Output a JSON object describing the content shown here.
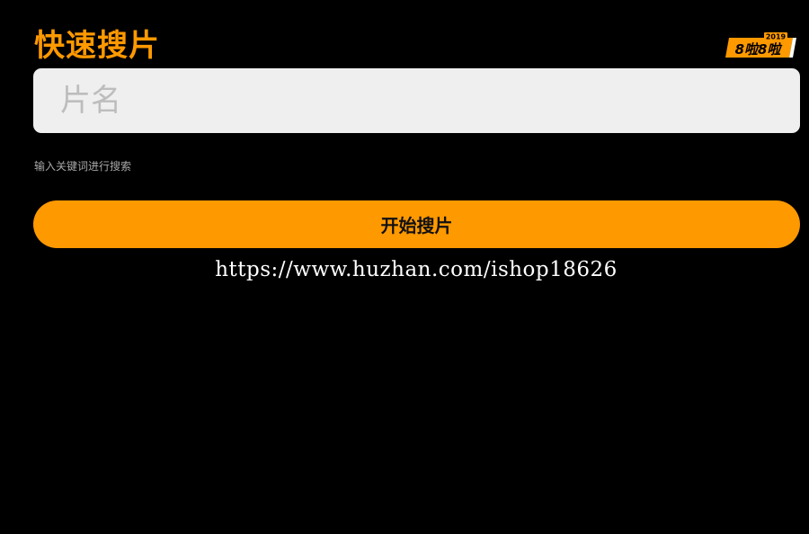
{
  "header": {
    "title": "快速搜片",
    "logo_icon": "brand-logo-icon",
    "logo_text": "8啦8啦",
    "logo_year": "2019"
  },
  "search": {
    "placeholder": "片名",
    "value": "",
    "hint": "输入关键词进行搜索"
  },
  "actions": {
    "start_label": "开始搜片"
  },
  "watermark": {
    "text": "https://www.huzhan.com/ishop18626"
  },
  "colors": {
    "accent": "#ff9900",
    "background": "#000000",
    "input_bg": "#efefef"
  }
}
